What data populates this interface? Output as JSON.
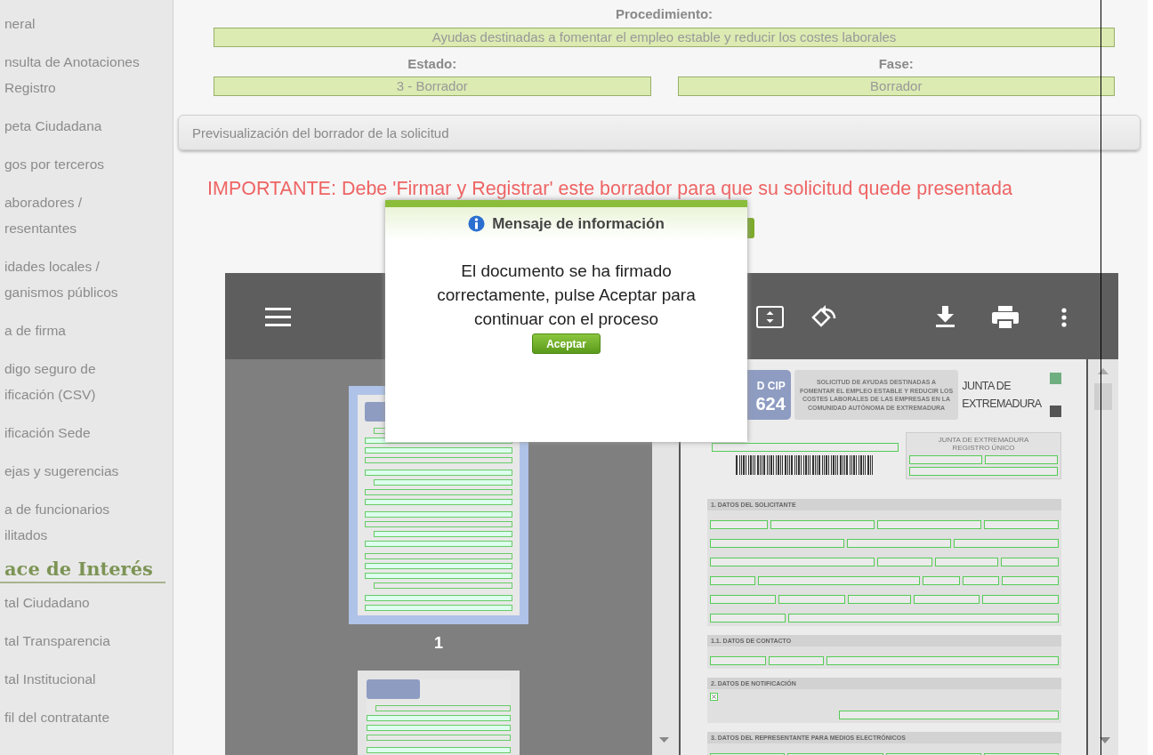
{
  "sidebar": {
    "items": [
      {
        "label": "neral"
      },
      {
        "label": "nsulta de Anotaciones\nRegistro"
      },
      {
        "label": "peta Ciudadana"
      },
      {
        "label": "gos por terceros"
      },
      {
        "label": "aboradores /\nresentantes"
      },
      {
        "label": "idades locales /\nganismos públicos"
      },
      {
        "label": "a de firma"
      },
      {
        "label": "digo seguro de\nificación (CSV)"
      },
      {
        "label": "ificación Sede"
      },
      {
        "label": "ejas y sugerencias"
      },
      {
        "label": "a de funcionarios\nilitados"
      }
    ],
    "heading": "ace de Interés",
    "links": [
      {
        "label": "tal Ciudadano"
      },
      {
        "label": "tal Transparencia"
      },
      {
        "label": "tal Institucional"
      },
      {
        "label": "fil del contratante"
      }
    ]
  },
  "procedure": {
    "label": "Procedimiento:",
    "value": "Ayudas destinadas a fomentar el empleo estable y reducir los costes laborales"
  },
  "status": {
    "label": "Estado:",
    "value": "3 - Borrador"
  },
  "phase": {
    "label": "Fase:",
    "value": "Borrador"
  },
  "panel": {
    "title": "Previsualización del borrador de la solicitud"
  },
  "notice": "IMPORTANTE: Debe 'Firmar y Registrar' este borrador para que su solicitud quede presentada",
  "viewer": {
    "thumbnails": [
      {
        "label": "1",
        "selected": true
      },
      {
        "selected": false
      }
    ],
    "document": {
      "cip": "D CIP",
      "cip_number": "624",
      "title": "SOLICITUD DE AYUDAS DESTINADAS A FOMENTAR EL EMPLEO ESTABLE Y REDUCIR LOS COSTES LABORALES DE LAS EMPRESAS EN LA COMUNIDAD AUTÓNOMA DE EXTREMADURA",
      "logo": [
        "JUNTA DE",
        "EXTREMADURA"
      ],
      "registry": [
        "JUNTA DE EXTREMADURA",
        "REGISTRO ÚNICO"
      ],
      "sections": [
        {
          "title": "1. DATOS DEL SOLICITANTE"
        },
        {
          "title": "1.1. DATOS DE CONTACTO"
        },
        {
          "title": "2. DATOS DE NOTIFICACIÓN",
          "checked": true
        },
        {
          "title": "3. DATOS DEL REPRESENTANTE PARA MEDIOS ELECTRÓNICOS"
        }
      ]
    }
  },
  "dialog": {
    "title": "Mensaje de información",
    "message": "El documento se ha firmado correctamente, pulse Aceptar para continuar con el proceso",
    "button": "Aceptar"
  }
}
